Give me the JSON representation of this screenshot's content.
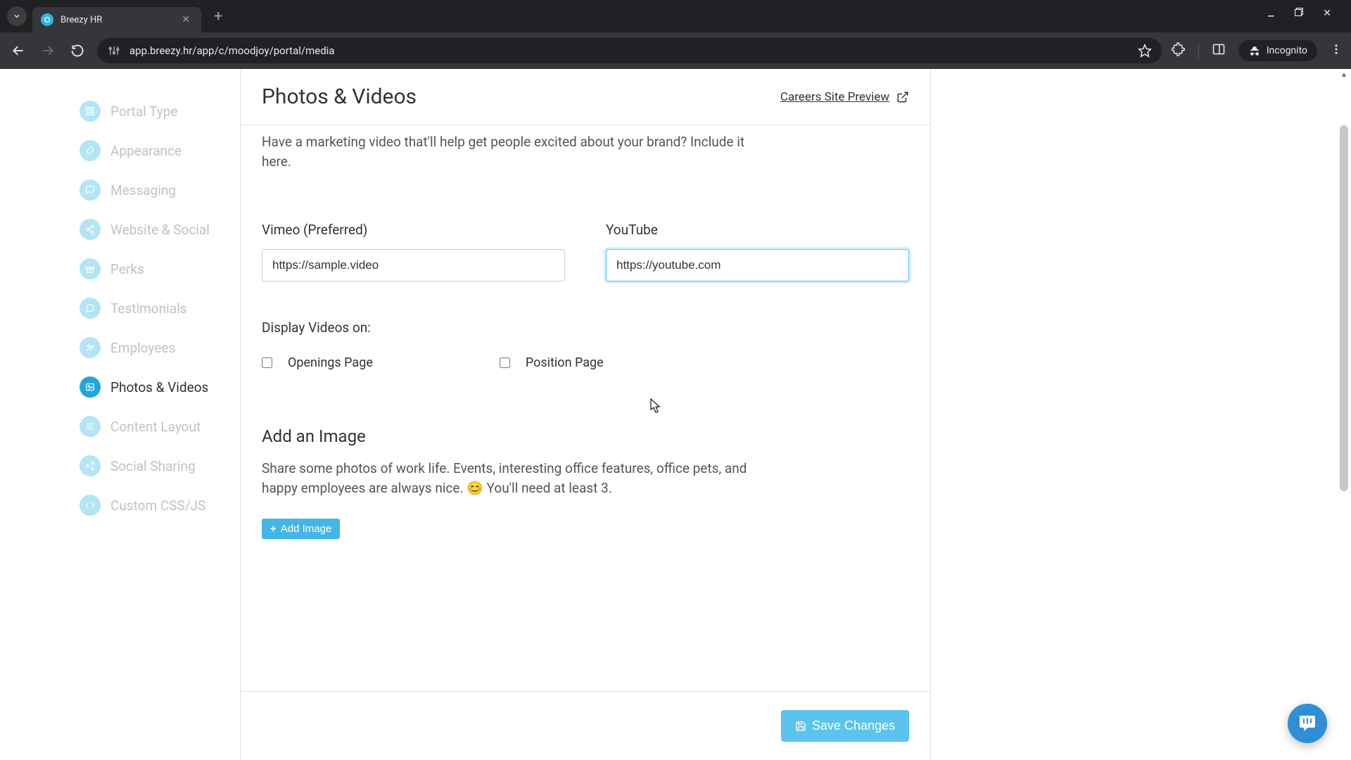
{
  "browser": {
    "tab_title": "Breezy HR",
    "url": "app.breezy.hr/app/c/moodjoy/portal/media",
    "incognito_label": "Incognito"
  },
  "sidebar": {
    "items": [
      {
        "label": "Portal Type",
        "active": false
      },
      {
        "label": "Appearance",
        "active": false
      },
      {
        "label": "Messaging",
        "active": false
      },
      {
        "label": "Website & Social",
        "active": false
      },
      {
        "label": "Perks",
        "active": false
      },
      {
        "label": "Testimonials",
        "active": false
      },
      {
        "label": "Employees",
        "active": false
      },
      {
        "label": "Photos & Videos",
        "active": true
      },
      {
        "label": "Content Layout",
        "active": false
      },
      {
        "label": "Social Sharing",
        "active": false
      },
      {
        "label": "Custom CSS/JS",
        "active": false
      }
    ]
  },
  "header": {
    "title": "Photos & Videos",
    "preview_label": "Careers Site Preview"
  },
  "videos": {
    "intro": "Have a marketing video that'll help get people excited about your brand? Include it here.",
    "vimeo_label": "Vimeo (Preferred)",
    "vimeo_value": "https://sample.video",
    "youtube_label": "YouTube",
    "youtube_value": "https://youtube.com",
    "display_label": "Display Videos on:",
    "openings_label": "Openings Page",
    "position_label": "Position Page",
    "openings_checked": false,
    "position_checked": false
  },
  "images": {
    "heading": "Add an Image",
    "desc": "Share some photos of work life. Events, interesting office features, office pets, and happy employees are always nice. 😊 You'll need at least 3.",
    "add_label": "Add Image"
  },
  "footer": {
    "save_label": "Save Changes"
  }
}
